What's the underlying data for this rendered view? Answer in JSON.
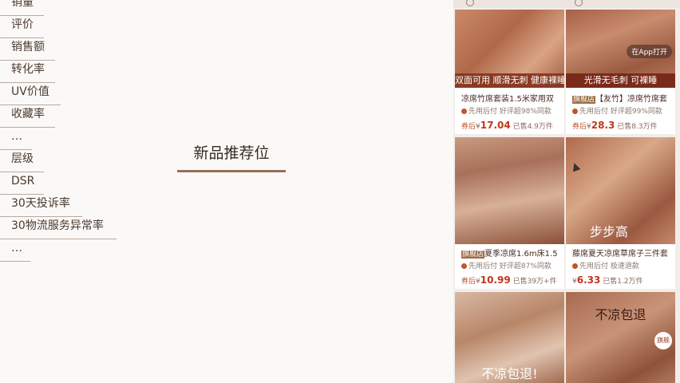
{
  "metrics": [
    "销量",
    "评价",
    "销售额",
    "转化率",
    "UV价值",
    "收藏率",
    "…",
    "层级",
    "DSR",
    "30天投诉率",
    "30物流服务异常率",
    "…"
  ],
  "center_title": "新品推荐位",
  "products": [
    {
      "image_banner": "光滑无毛刺 可裸睡",
      "image_tag_lines": [
        "双面可用",
        "顺滑无刺 健康裸睡"
      ],
      "title": "凉席竹席套装1.5米家用双",
      "brand": "",
      "meta": "先用后付 好评超98%同款",
      "coupon_label": "券后",
      "price": "17.04",
      "sold": "已售4.9万件"
    },
    {
      "image_banner": "光滑无毛刺 可裸睡",
      "open_app": "在App打开",
      "title": "【友竹】凉席竹席套",
      "brand": "旗舰店",
      "meta": "先用后付 好评超99%同款",
      "coupon_label": "券后",
      "price": "28.3",
      "sold": "已售8.3万件"
    },
    {
      "image_banner": "",
      "title": "夏季凉席1.6m床1.5",
      "brand": "旗舰店",
      "meta": "先用后付 好评超87%同款",
      "coupon_label": "券后",
      "price": "10.99",
      "sold": "已售39万+件"
    },
    {
      "image_banner": "步步高",
      "title": "藤席夏天凉席草席子三件套",
      "brand": "",
      "meta": "先用后付 极速退款",
      "coupon_label": "",
      "price": "6.33",
      "sold": "已售1.2万件"
    },
    {
      "image_banner": "不凉包退",
      "title": "",
      "brand": "",
      "meta": "",
      "coupon_label": "",
      "price": "",
      "sold": "",
      "bottom_text": "不凉包退!"
    },
    {
      "image_banner": "不凉包退",
      "badge": "旗舰",
      "title": "",
      "brand": "",
      "meta": "",
      "coupon_label": "",
      "price": "",
      "sold": ""
    }
  ],
  "colors": {
    "background": "#fbf9f7",
    "accent": "#9a6e58",
    "price": "#c0361c"
  }
}
